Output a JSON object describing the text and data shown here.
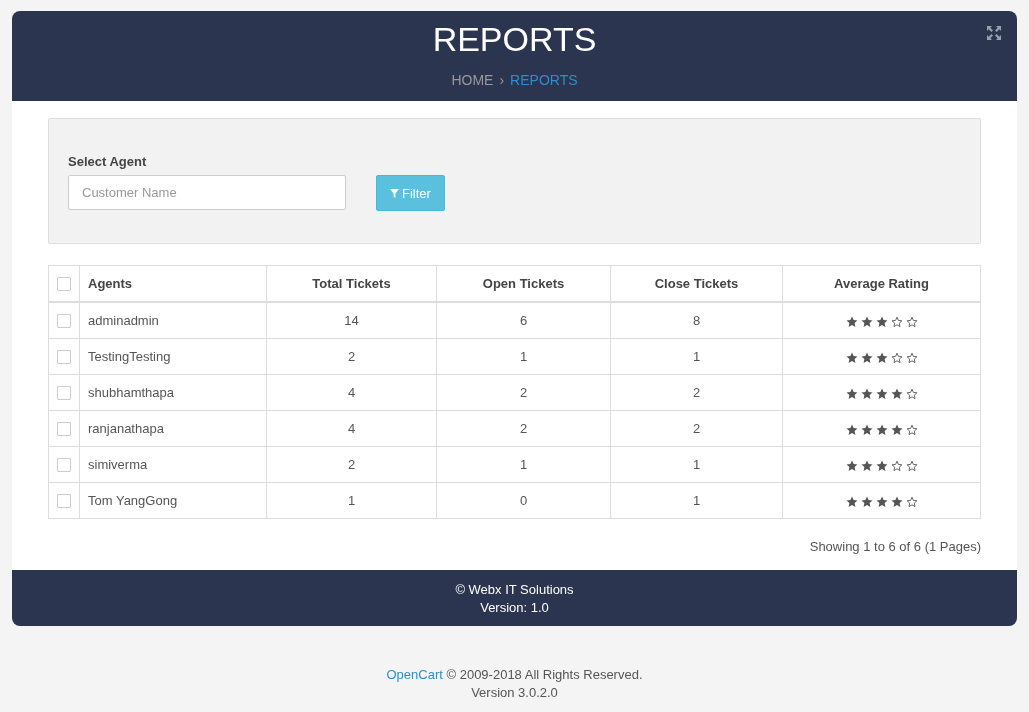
{
  "header": {
    "title": "REPORTS",
    "breadcrumb_separator": "›",
    "breadcrumb": [
      {
        "label": "HOME",
        "selected": false
      },
      {
        "label": "REPORTS",
        "selected": true
      }
    ]
  },
  "filter": {
    "label": "Select Agent",
    "placeholder": "Customer Name",
    "button": "Filter"
  },
  "table": {
    "select_all": {
      "checked": false
    },
    "columns": [
      "Agents",
      "Total Tickets",
      "Open Tickets",
      "Close Tickets",
      "Average Rating"
    ],
    "rows": [
      {
        "checked": false,
        "agent": "adminadmin",
        "total": "14",
        "open": "6",
        "close": "8",
        "stars": 3
      },
      {
        "checked": false,
        "agent": "TestingTesting",
        "total": "2",
        "open": "1",
        "close": "1",
        "stars": 3
      },
      {
        "checked": false,
        "agent": "shubhamthapa",
        "total": "4",
        "open": "2",
        "close": "2",
        "stars": 4
      },
      {
        "checked": false,
        "agent": "ranjanathapa",
        "total": "4",
        "open": "2",
        "close": "2",
        "stars": 4
      },
      {
        "checked": false,
        "agent": "simiverma",
        "total": "2",
        "open": "1",
        "close": "1",
        "stars": 3
      },
      {
        "checked": false,
        "agent": "Tom YangGong",
        "total": "1",
        "open": "0",
        "close": "1",
        "stars": 4
      }
    ]
  },
  "pagination": "Showing 1 to 6 of 6 (1 Pages)",
  "card_footer": {
    "copyright": "© Webx IT Solutions",
    "version": "Version: 1.0"
  },
  "page_footer": {
    "link": "OpenCart",
    "text": "© 2009-2018 All Rights Reserved.",
    "version": "Version 3.0.2.0"
  }
}
